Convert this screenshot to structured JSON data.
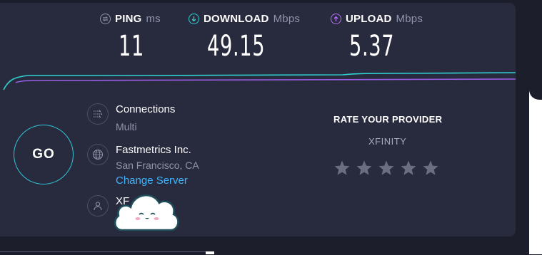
{
  "metrics": {
    "ping": {
      "label": "PING",
      "unit": "ms",
      "value": "11",
      "color": "#ffffff"
    },
    "download": {
      "label": "DOWNLOAD",
      "unit": "Mbps",
      "value": "49.15",
      "color": "#2fd1d1"
    },
    "upload": {
      "label": "UPLOAD",
      "unit": "Mbps",
      "value": "5.37",
      "color": "#b576f5"
    }
  },
  "go_button": {
    "label": "GO"
  },
  "connections": {
    "title": "Connections",
    "value": "Multi",
    "icon": "connections-icon"
  },
  "server": {
    "name": "Fastmetrics Inc.",
    "location": "San Francisco, CA",
    "change_label": "Change Server",
    "icon": "globe-icon"
  },
  "provider": {
    "name_partial": "XF",
    "icon": "user-icon"
  },
  "rating": {
    "title": "RATE YOUR PROVIDER",
    "isp": "XFINITY",
    "stars": 5,
    "star_color": "#6b6e80"
  },
  "colors": {
    "background": "#1d1e2c",
    "card": "#282a3d",
    "accent": "#2fc6d6",
    "link": "#3fb4ff"
  }
}
